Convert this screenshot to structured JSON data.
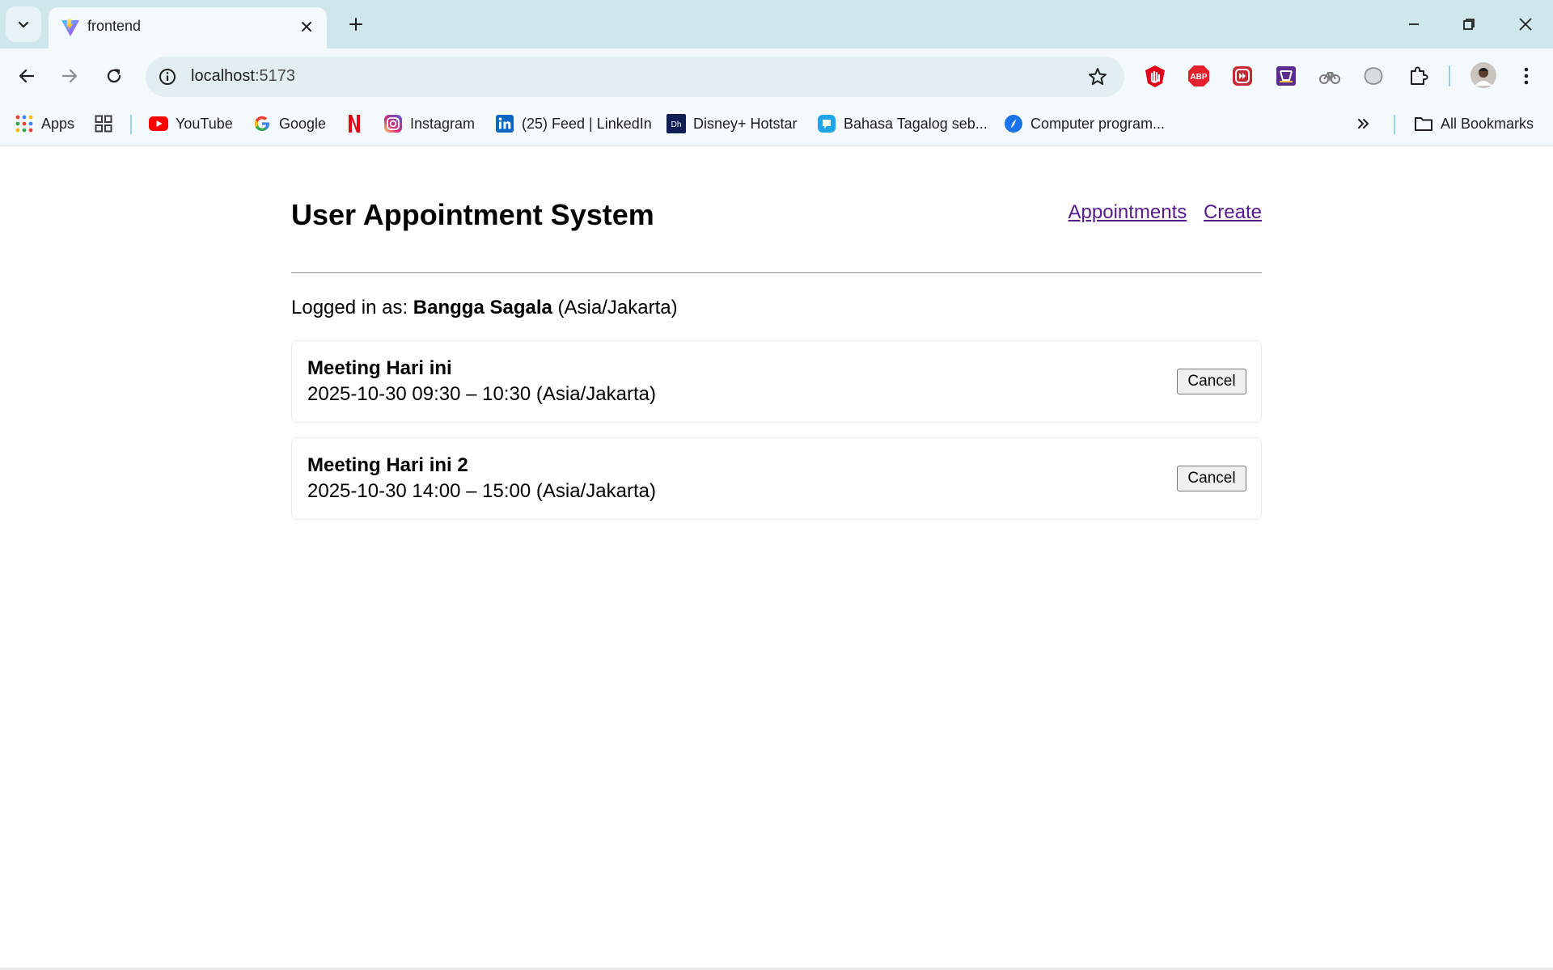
{
  "browser": {
    "tab_title": "frontend",
    "url_host": "localhost",
    "url_port": ":5173",
    "bookmarks": [
      {
        "label": "Apps",
        "icon": "apps-grid-icon"
      },
      {
        "label": "YouTube",
        "icon": "youtube-icon"
      },
      {
        "label": "Google",
        "icon": "google-icon"
      },
      {
        "label": "Instagram",
        "icon": "instagram-icon"
      },
      {
        "label": "(25) Feed | LinkedIn",
        "icon": "linkedin-icon"
      },
      {
        "label": "Disney+ Hotstar",
        "icon": "hotstar-icon"
      },
      {
        "label": "Bahasa Tagalog seb...",
        "icon": "chat-icon"
      },
      {
        "label": "Computer program...",
        "icon": "compass-icon"
      }
    ],
    "all_bookmarks": "All Bookmarks"
  },
  "app": {
    "title": "User Appointment System",
    "nav": {
      "appointments": "Appointments",
      "create": "Create"
    },
    "logged_in_prefix": "Logged in as:",
    "user_name": "Bangga Sagala",
    "user_tz": "(Asia/Jakarta)",
    "appointments": [
      {
        "title": "Meeting Hari ini",
        "time": "2025-10-30 09:30 – 10:30 (Asia/Jakarta)",
        "cancel_label": "Cancel"
      },
      {
        "title": "Meeting Hari ini 2",
        "time": "2025-10-30 14:00 – 15:00 (Asia/Jakarta)",
        "cancel_label": "Cancel"
      }
    ]
  },
  "colors": {
    "tabstrip_bg": "#cfe6ec",
    "toolbar_bg": "#f4f9fb",
    "link": "#551a8b"
  }
}
